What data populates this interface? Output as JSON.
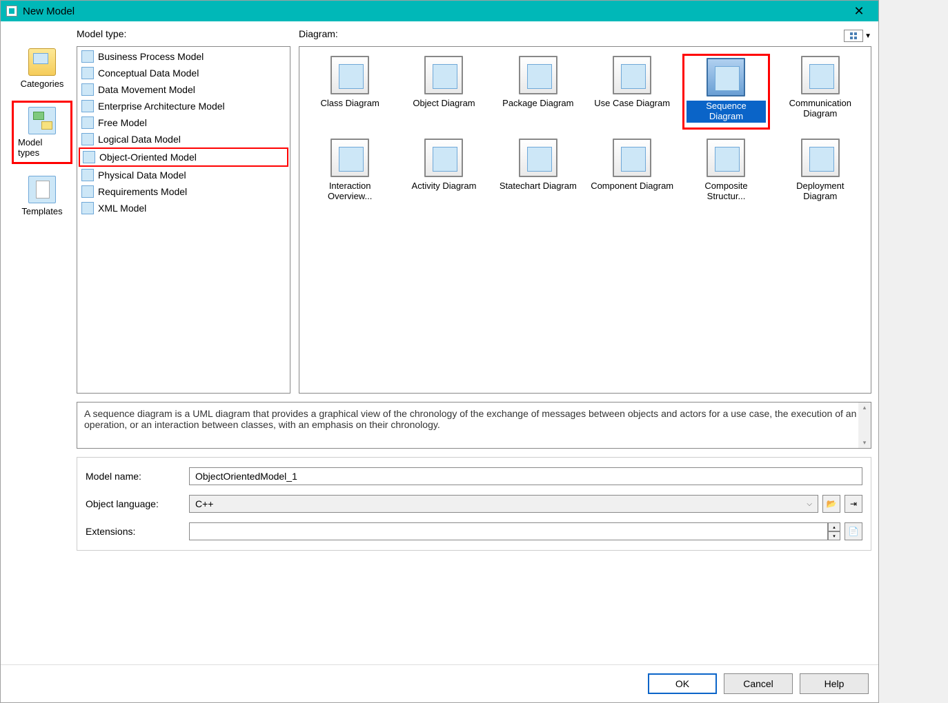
{
  "window": {
    "title": "New Model",
    "close": "✕"
  },
  "leftNav": {
    "categories": "Categories",
    "modelTypes": "Model types",
    "templates": "Templates"
  },
  "labels": {
    "modelType": "Model type:",
    "diagram": "Diagram:"
  },
  "modelTypes": [
    "Business Process Model",
    "Conceptual Data Model",
    "Data Movement Model",
    "Enterprise Architecture Model",
    "Free Model",
    "Logical Data Model",
    "Object-Oriented Model",
    "Physical Data Model",
    "Requirements Model",
    "XML Model"
  ],
  "selectedModelType": 6,
  "diagrams": [
    "Class Diagram",
    "Object Diagram",
    "Package Diagram",
    "Use Case Diagram",
    "Sequence Diagram",
    "Communication Diagram",
    "Interaction Overview...",
    "Activity Diagram",
    "Statechart Diagram",
    "Component Diagram",
    "Composite Structur...",
    "Deployment Diagram"
  ],
  "selectedDiagram": 4,
  "description": "A sequence diagram is a UML diagram that provides a graphical view of the chronology of the exchange of messages between objects and actors for a use case, the execution of an operation, or an interaction between classes, with an emphasis on their chronology.",
  "form": {
    "modelNameLabel": "Model name:",
    "modelName": "ObjectOrientedModel_1",
    "objectLanguageLabel": "Object language:",
    "objectLanguage": "C++",
    "extensionsLabel": "Extensions:",
    "extensions": ""
  },
  "buttons": {
    "ok": "OK",
    "cancel": "Cancel",
    "help": "Help"
  }
}
